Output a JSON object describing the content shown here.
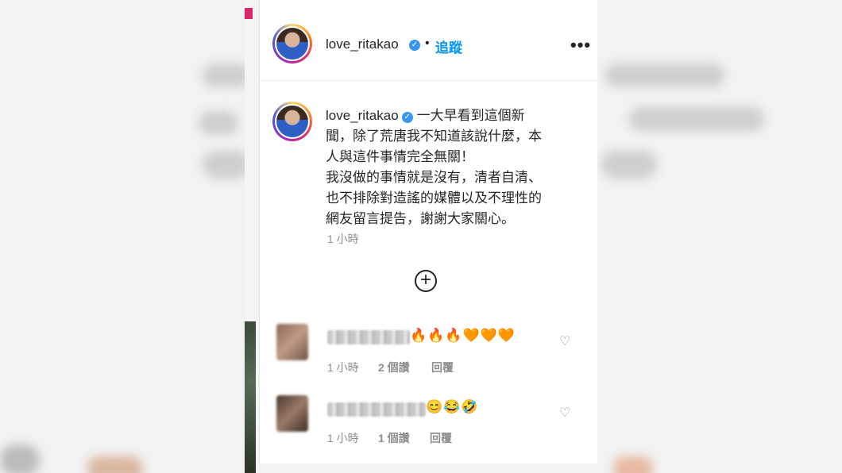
{
  "post": {
    "username": "love_ritakao",
    "dot": "•",
    "follow_label": "追蹤",
    "more_label": "•••",
    "verified_glyph": "✓"
  },
  "caption": {
    "username": "love_ritakao",
    "text": "一大早看到這個新\n聞，除了荒唐我不知道該說什麼，本\n人與這件事情完全無關！\n我沒做的事情就是沒有，清者自清、\n也不排除對造謠的媒體以及不理性的\n網友留言提告，謝謝大家關心。",
    "time": "1 小時"
  },
  "load_more_label": "+",
  "comments": [
    {
      "emojis": "🔥🔥🔥🧡🧡🧡",
      "time": "1 小時",
      "likes": "2 個讚",
      "reply": "回覆",
      "heart": "♡"
    },
    {
      "emojis": "😊😂🤣",
      "time": "1 小時",
      "likes": "1 個讚",
      "reply": "回覆",
      "heart": "♡"
    }
  ],
  "colors": {
    "accent": "#0095f6",
    "verified": "#3897f0",
    "meta_text": "#8e8e8e"
  }
}
